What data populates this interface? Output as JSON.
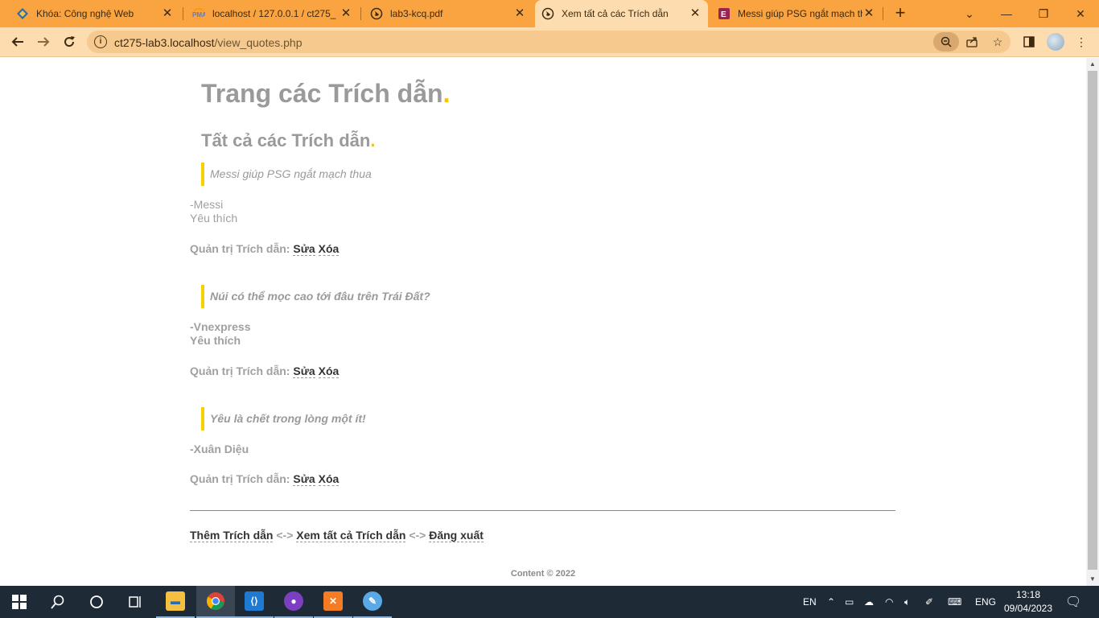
{
  "browser": {
    "tabs": [
      {
        "title": "Khóa: Công nghệ Web",
        "icon": "diamond-icon"
      },
      {
        "title": "localhost / 127.0.0.1 / ct275_",
        "icon": "phpmyadmin-icon"
      },
      {
        "title": "lab3-kcq.pdf",
        "icon": "globe-icon"
      },
      {
        "title": "Xem tất cả các Trích dẫn",
        "icon": "globe-icon"
      },
      {
        "title": "Messi giúp PSG ngắt mạch th",
        "icon": "news-icon"
      }
    ],
    "url_host": "ct275-lab3.localhost",
    "url_path": "/view_quotes.php",
    "accent": "#f9a341"
  },
  "page": {
    "title": "Trang các Trích dẫn",
    "title_dot": ".",
    "subtitle": "Tất cả các Trích dẫn",
    "subtitle_dot": ".",
    "quotes": [
      {
        "text": "Messi giúp PSG ngắt mạch thua",
        "author": "-Messi",
        "favorite": "Yêu thích",
        "bold": false
      },
      {
        "text": "Núi có thể mọc cao tới đâu trên Trái Đất?",
        "author": "-Vnexpress",
        "favorite": "Yêu thích",
        "bold": true
      },
      {
        "text": "Yêu là chết trong lòng một ít!",
        "author": "-Xuân Diệu",
        "favorite": "",
        "bold": true
      }
    ],
    "admin_label": "Quản trị Trích dẫn:",
    "edit_label": "Sửa",
    "delete_label": "Xóa",
    "footer": {
      "add_label": "Thêm Trích dẫn",
      "sep": "<->",
      "view_all_label": "Xem tất cả Trích dẫn",
      "logout_label": "Đăng xuất",
      "copyright": "Content © 2022"
    },
    "highlight_color": "#f7d000"
  },
  "taskbar": {
    "language": "EN",
    "ime": "ENG",
    "time": "13:18",
    "date": "09/04/2023"
  }
}
